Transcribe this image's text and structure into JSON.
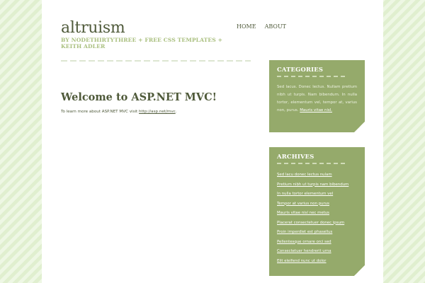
{
  "header": {
    "logo": "altruism",
    "tagline": "BY NODETHIRTYTHREE + FREE CSS TEMPLATES + KEITH ADLER"
  },
  "nav": {
    "home": "HOME",
    "about": "ABOUT"
  },
  "main": {
    "title": "Welcome to ASP.NET MVC!",
    "text_prefix": "To learn more about ASP.NET MVC visit ",
    "link": "http://asp.net/mvc",
    "text_suffix": "."
  },
  "sidebar": {
    "categories": {
      "title": "CATEGORIES",
      "text": "Sed lacus. Donec lectus. Nullam pretium nibh ut turpis. Nam bibendum. In nulla tortor, elementum vel, tempor at, varius non, purus.",
      "link": "Mauris vitae nisl."
    },
    "archives": {
      "title": "ARCHIVES",
      "items": [
        "Sed lacu donec lectus nulam",
        "Pretium nibh ut turpis nam bibendum",
        "In nulla tortor elementum vel",
        "Tempor at varius non purus",
        "Mauris vitae nisl nec metus",
        "Placerat consectetuer donec ipsum",
        "Proin imperdiet est phasellus",
        "Pellentesque ornare orci sed",
        "Consectetuer hendrerit urna",
        "Elit eleifend nunc ut dolor"
      ]
    }
  },
  "colors": {
    "olive_text": "#4f5a3a",
    "tagline_green": "#a9bf7e",
    "sidebar_box": "#95aa6b",
    "background_stripe": "#e4f2d4"
  }
}
